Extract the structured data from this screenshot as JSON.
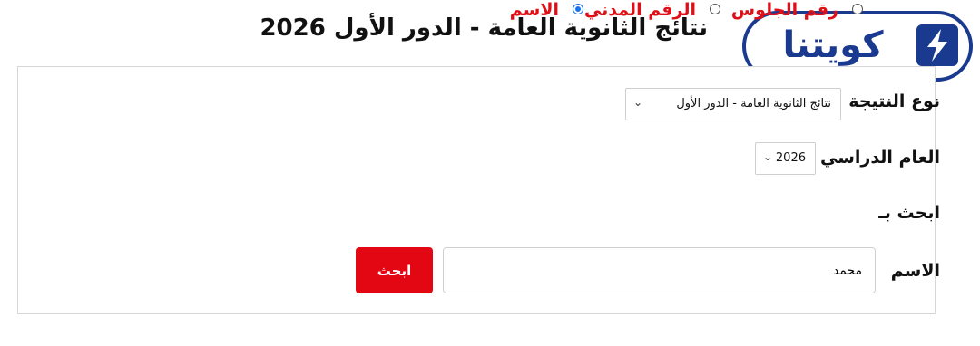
{
  "header": {
    "title": "نتائج الثانوية العامة - الدور الأول 2026"
  },
  "logo": {
    "text": "كويتنا",
    "icon": "logo-lightning-icon",
    "color": "#1a3a8f"
  },
  "form": {
    "result_type": {
      "label": "نوع النتيجة",
      "selected": "نتائج الثانوية العامة - الدور الأول"
    },
    "academic_year": {
      "label": "العام الدراسي",
      "selected": "2026"
    },
    "search_by": {
      "label": "ابحث بـ",
      "options": [
        {
          "label": "رقم الجلوس",
          "checked": false
        },
        {
          "label": "الرقم المدني",
          "checked": false
        },
        {
          "label": "الاسم",
          "checked": true
        }
      ]
    },
    "name": {
      "label": "الاسم",
      "value": "محمد"
    },
    "submit_label": "ابحث"
  },
  "colors": {
    "accent_red": "#e30613",
    "radio_text_red": "#e00f17",
    "radio_selected_blue": "#1a73e8"
  }
}
